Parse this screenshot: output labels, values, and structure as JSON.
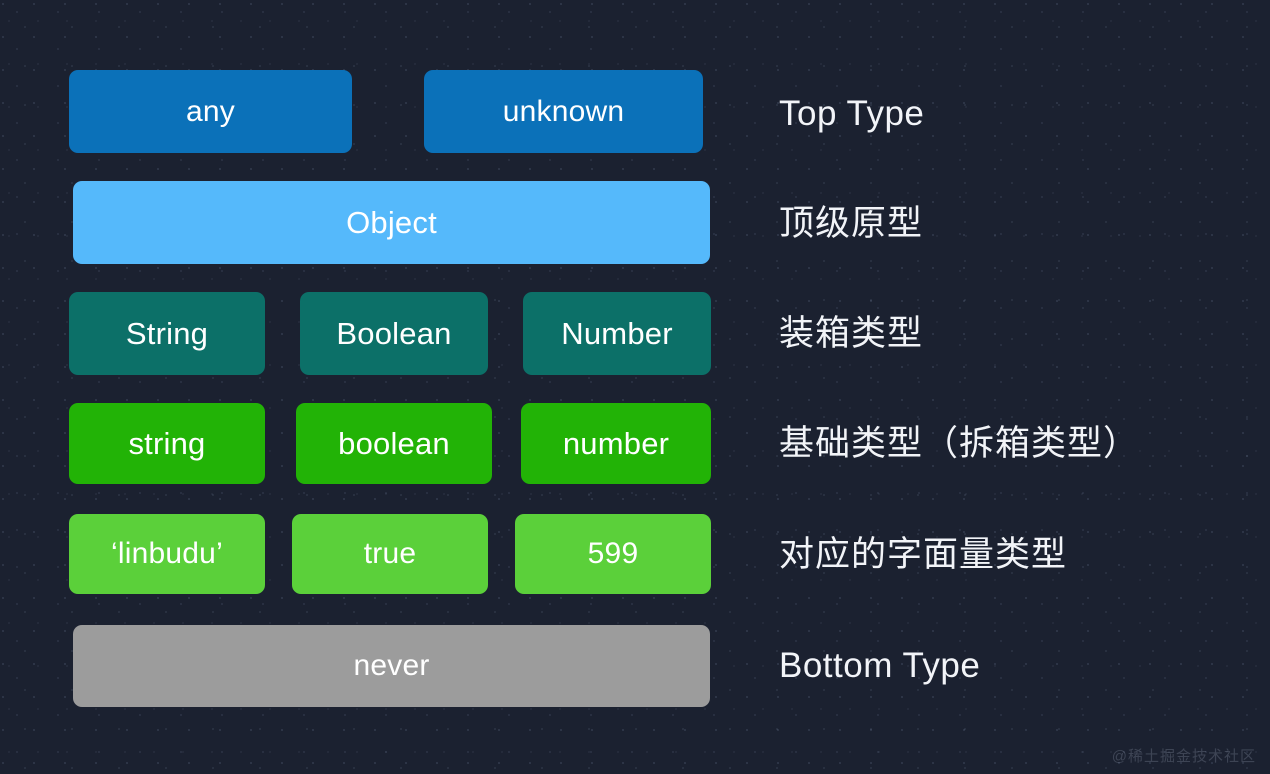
{
  "background_color": "#1b2130",
  "text_color": "#ffffff",
  "palette": {
    "top_type": "#0b71b9",
    "prototype": "#55b9fb",
    "boxed": "#0c7068",
    "primitive": "#22b306",
    "literal": "#5bd03a",
    "bottom_type": "#9c9c9c"
  },
  "rows": [
    {
      "id": "top-type",
      "label": "Top Type",
      "label_lang": "latin",
      "chips": [
        {
          "id": "any",
          "text": "any"
        },
        {
          "id": "unknown",
          "text": "unknown"
        }
      ]
    },
    {
      "id": "prototype",
      "label": "顶级原型",
      "label_lang": "cjk",
      "chips": [
        {
          "id": "object",
          "text": "Object"
        }
      ]
    },
    {
      "id": "boxed",
      "label": "装箱类型",
      "label_lang": "cjk",
      "chips": [
        {
          "id": "String",
          "text": "String"
        },
        {
          "id": "Boolean",
          "text": "Boolean"
        },
        {
          "id": "Number",
          "text": "Number"
        }
      ]
    },
    {
      "id": "primitive",
      "label": "基础类型（拆箱类型）",
      "label_lang": "cjk",
      "chips": [
        {
          "id": "string",
          "text": "string"
        },
        {
          "id": "boolean",
          "text": "boolean"
        },
        {
          "id": "number",
          "text": "number"
        }
      ]
    },
    {
      "id": "literal",
      "label": "对应的字面量类型",
      "label_lang": "cjk",
      "chips": [
        {
          "id": "linbudu",
          "text": "‘linbudu’"
        },
        {
          "id": "true",
          "text": "true"
        },
        {
          "id": "599",
          "text": "599"
        }
      ]
    },
    {
      "id": "bottom-type",
      "label": "Bottom Type",
      "label_lang": "latin",
      "chips": [
        {
          "id": "never",
          "text": "never"
        }
      ]
    }
  ],
  "watermark": "@稀土掘金技术社区"
}
